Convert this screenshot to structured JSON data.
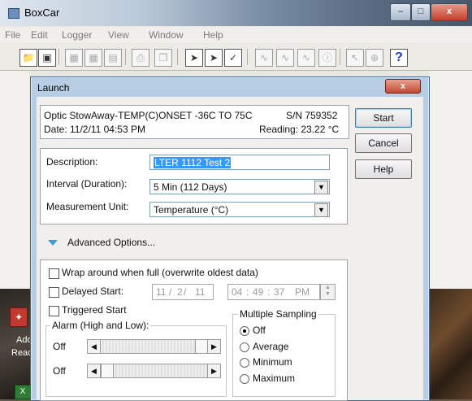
{
  "app": {
    "title": "BoxCar",
    "menu": [
      "File",
      "Edit",
      "Logger",
      "View",
      "Window",
      "Help"
    ]
  },
  "desktop": {
    "icon_label_1": "Ado",
    "icon_label_2": "Read"
  },
  "dialog": {
    "title": "Launch",
    "close_label": "x",
    "info": {
      "device": "Optic StowAway-TEMP(C)ONSET -36C TO 75C",
      "serial": "S/N 759352",
      "date": "Date: 11/2/11 04:53 PM",
      "reading": "Reading: 23.22 °C"
    },
    "buttons": {
      "start": "Start",
      "cancel": "Cancel",
      "help": "Help"
    },
    "params": {
      "description_label": "Description:",
      "description_value": "LTER 1112 Test 2",
      "interval_label": "Interval (Duration):",
      "interval_value": "5 Min (112 Days)",
      "unit_label": "Measurement Unit:",
      "unit_value": "Temperature  (°C)"
    },
    "advanced": {
      "toggle_label": "Advanced Options...",
      "wrap_label": "Wrap around when full (overwrite oldest data)",
      "delayed_label": "Delayed Start:",
      "triggered_label": "Triggered Start",
      "date": {
        "month": "11",
        "day": "2",
        "year": "11",
        "sep": "/"
      },
      "time": {
        "hour": "04",
        "minute": "49",
        "second": "37",
        "ampm": "PM",
        "sep": ":"
      },
      "alarm": {
        "title": "Alarm (High and Low):",
        "high_value": "Off",
        "low_value": "Off"
      },
      "sampling": {
        "title": "Multiple Sampling",
        "options": [
          "Off",
          "Average",
          "Minimum",
          "Maximum"
        ],
        "selected": "Off"
      }
    }
  }
}
